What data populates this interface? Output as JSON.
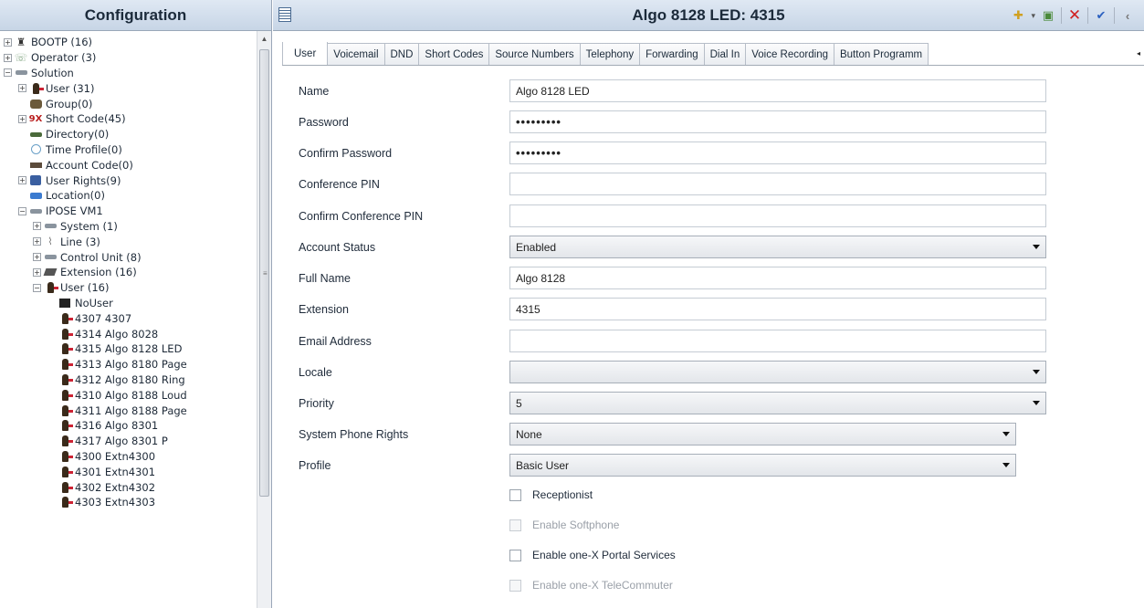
{
  "left_pane": {
    "title": "Configuration",
    "tree": [
      {
        "label": "BOOTP (16)",
        "icon": "bootp-icon",
        "expander": "+",
        "indent": 0
      },
      {
        "label": "Operator (3)",
        "icon": "operator-icon",
        "expander": "+",
        "indent": 0
      },
      {
        "label": "Solution",
        "icon": "solution-server-icon",
        "expander": "−",
        "indent": 0
      },
      {
        "label": "User (31)",
        "icon": "user-icon",
        "expander": "+",
        "indent": 1
      },
      {
        "label": "Group(0)",
        "icon": "group-icon",
        "expander": "",
        "indent": 1
      },
      {
        "label": "Short Code(45)",
        "icon": "short-code-icon",
        "expander": "+",
        "indent": 1
      },
      {
        "label": "Directory(0)",
        "icon": "directory-icon",
        "expander": "",
        "indent": 1
      },
      {
        "label": "Time Profile(0)",
        "icon": "time-profile-icon",
        "expander": "",
        "indent": 1
      },
      {
        "label": "Account Code(0)",
        "icon": "account-code-icon",
        "expander": "",
        "indent": 1
      },
      {
        "label": "User Rights(9)",
        "icon": "user-rights-icon",
        "expander": "+",
        "indent": 1
      },
      {
        "label": "Location(0)",
        "icon": "location-icon",
        "expander": "",
        "indent": 1
      },
      {
        "label": "IPOSE VM1",
        "icon": "server-icon",
        "expander": "−",
        "indent": 1
      },
      {
        "label": "System (1)",
        "icon": "system-icon",
        "expander": "+",
        "indent": 2
      },
      {
        "label": "Line (3)",
        "icon": "line-icon",
        "expander": "+",
        "indent": 2
      },
      {
        "label": "Control Unit (8)",
        "icon": "control-unit-icon",
        "expander": "+",
        "indent": 2
      },
      {
        "label": "Extension (16)",
        "icon": "extension-icon",
        "expander": "+",
        "indent": 2
      },
      {
        "label": "User (16)",
        "icon": "user-icon",
        "expander": "−",
        "indent": 2
      },
      {
        "label": "NoUser",
        "icon": "no-user-icon",
        "expander": "",
        "indent": 3
      },
      {
        "label": "4307 4307",
        "icon": "user-icon",
        "expander": "",
        "indent": 3
      },
      {
        "label": "4314 Algo 8028",
        "icon": "user-icon",
        "expander": "",
        "indent": 3
      },
      {
        "label": "4315 Algo 8128 LED",
        "icon": "user-icon",
        "expander": "",
        "indent": 3
      },
      {
        "label": "4313 Algo 8180 Page",
        "icon": "user-icon",
        "expander": "",
        "indent": 3
      },
      {
        "label": "4312 Algo 8180 Ring",
        "icon": "user-icon",
        "expander": "",
        "indent": 3
      },
      {
        "label": "4310 Algo 8188 Loud",
        "icon": "user-icon",
        "expander": "",
        "indent": 3
      },
      {
        "label": "4311 Algo 8188 Page",
        "icon": "user-icon",
        "expander": "",
        "indent": 3
      },
      {
        "label": "4316 Algo 8301",
        "icon": "user-icon",
        "expander": "",
        "indent": 3
      },
      {
        "label": "4317 Algo 8301 P",
        "icon": "user-icon",
        "expander": "",
        "indent": 3
      },
      {
        "label": "4300 Extn4300",
        "icon": "user-icon",
        "expander": "",
        "indent": 3
      },
      {
        "label": "4301 Extn4301",
        "icon": "user-icon",
        "expander": "",
        "indent": 3
      },
      {
        "label": "4302 Extn4302",
        "icon": "user-icon",
        "expander": "",
        "indent": 3
      },
      {
        "label": "4303 Extn4303",
        "icon": "user-icon",
        "expander": "",
        "indent": 3
      }
    ]
  },
  "header": {
    "title": "Algo 8128 LED: 4315"
  },
  "tabs": [
    {
      "label": "User",
      "active": true
    },
    {
      "label": "Voicemail",
      "active": false
    },
    {
      "label": "DND",
      "active": false
    },
    {
      "label": "Short Codes",
      "active": false
    },
    {
      "label": "Source Numbers",
      "active": false
    },
    {
      "label": "Telephony",
      "active": false
    },
    {
      "label": "Forwarding",
      "active": false
    },
    {
      "label": "Dial In",
      "active": false
    },
    {
      "label": "Voice Recording",
      "active": false
    },
    {
      "label": "Button Programm",
      "active": false
    }
  ],
  "form": {
    "name": {
      "label": "Name",
      "value": "Algo 8128 LED"
    },
    "password": {
      "label": "Password",
      "value": "•••••••••"
    },
    "confirm_password": {
      "label": "Confirm Password",
      "value": "•••••••••"
    },
    "conference_pin": {
      "label": "Conference PIN",
      "value": ""
    },
    "confirm_conference_pin": {
      "label": "Confirm Conference PIN",
      "value": ""
    },
    "account_status": {
      "label": "Account Status",
      "value": "Enabled"
    },
    "full_name": {
      "label": "Full Name",
      "value": "Algo 8128"
    },
    "extension": {
      "label": "Extension",
      "value": "4315"
    },
    "email_address": {
      "label": "Email Address",
      "value": ""
    },
    "locale": {
      "label": "Locale",
      "value": ""
    },
    "priority": {
      "label": "Priority",
      "value": "5"
    },
    "system_phone_rights": {
      "label": "System Phone Rights",
      "value": "None"
    },
    "profile": {
      "label": "Profile",
      "value": "Basic User"
    },
    "checkboxes": {
      "receptionist": {
        "label": "Receptionist",
        "checked": false,
        "enabled": true
      },
      "enable_softphone": {
        "label": "Enable Softphone",
        "checked": false,
        "enabled": false
      },
      "enable_onex_portal": {
        "label": "Enable one-X Portal Services",
        "checked": false,
        "enabled": true
      },
      "enable_onex_telecommuter": {
        "label": "Enable one-X TeleCommuter",
        "checked": false,
        "enabled": false
      }
    }
  }
}
